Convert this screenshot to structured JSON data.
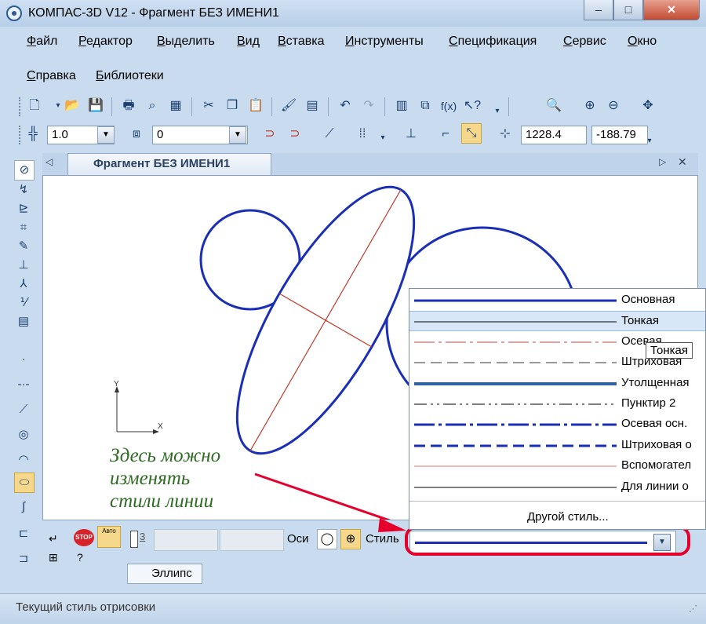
{
  "window": {
    "title": "КОМПАС-3D V12 - Фрагмент БЕЗ ИМЕНИ1",
    "minimize": "–",
    "maximize": "□",
    "close": "✕"
  },
  "menu": [
    {
      "label": "Файл"
    },
    {
      "label": "Редактор"
    },
    {
      "label": "Выделить"
    },
    {
      "label": "Вид"
    },
    {
      "label": "Вставка"
    },
    {
      "label": "Инструменты"
    },
    {
      "label": "Спецификация"
    },
    {
      "label": "Сервис"
    },
    {
      "label": "Окно"
    },
    {
      "label": "Справка"
    },
    {
      "label": "Библиотеки"
    }
  ],
  "current_params": {
    "step": "1.0",
    "layer": "0",
    "coord_x": "1228.4",
    "coord_y": "-188.79"
  },
  "document_tab": {
    "title": "Фрагмент БЕЗ ИМЕНИ1",
    "nav_prev": "◁",
    "nav_next": "▷",
    "close": "✕"
  },
  "canvas": {
    "axis_x": "X",
    "axis_y": "Y",
    "annotation": [
      "Здесь можно",
      "изменять",
      "стили линии"
    ]
  },
  "style_options": [
    {
      "label": "Основная",
      "color": "#1a2fb5",
      "dash": "solid",
      "weight": 3
    },
    {
      "label": "Тонкая",
      "color": "#000000",
      "dash": "solid",
      "weight": 1
    },
    {
      "label": "Осевая",
      "color": "#d1403a",
      "dash": "dashdot",
      "weight": 1
    },
    {
      "label": "Штриховая",
      "color": "#333333",
      "dash": "dashed",
      "weight": 1
    },
    {
      "label": "Утолщенная",
      "color": "#2a62b0",
      "dash": "solid",
      "weight": 4
    },
    {
      "label": "Пунктир 2",
      "color": "#000000",
      "dash": "dashdot2",
      "weight": 1
    },
    {
      "label": "Осевая осн.",
      "color": "#1a2fb5",
      "dash": "dashdot",
      "weight": 3
    },
    {
      "label": "Штриховая о",
      "color": "#1a2fb5",
      "dash": "dashed",
      "weight": 3
    },
    {
      "label": "Вспомогател",
      "color": "#e07a6e",
      "dash": "solid",
      "weight": 1
    },
    {
      "label": "Для линии о",
      "color": "#000000",
      "dash": "solid",
      "weight": 1
    }
  ],
  "selected_style": "Тонкая",
  "other_style": "Другой стиль...",
  "tooltip": "Тонкая",
  "property_panel": {
    "point_index": "3",
    "axes_label": "Оси",
    "style_label": "Стиль",
    "panel_tab": "Эллипс",
    "stop_badge": "STOP",
    "auto_badge": "Авто"
  },
  "status": {
    "text": "Текущий стиль отрисовки"
  },
  "colors": {
    "highlight": "#e4002b",
    "main_line": "#1a2fb5",
    "axis_line": "#c0392b",
    "annotation": "#2f6b24"
  }
}
